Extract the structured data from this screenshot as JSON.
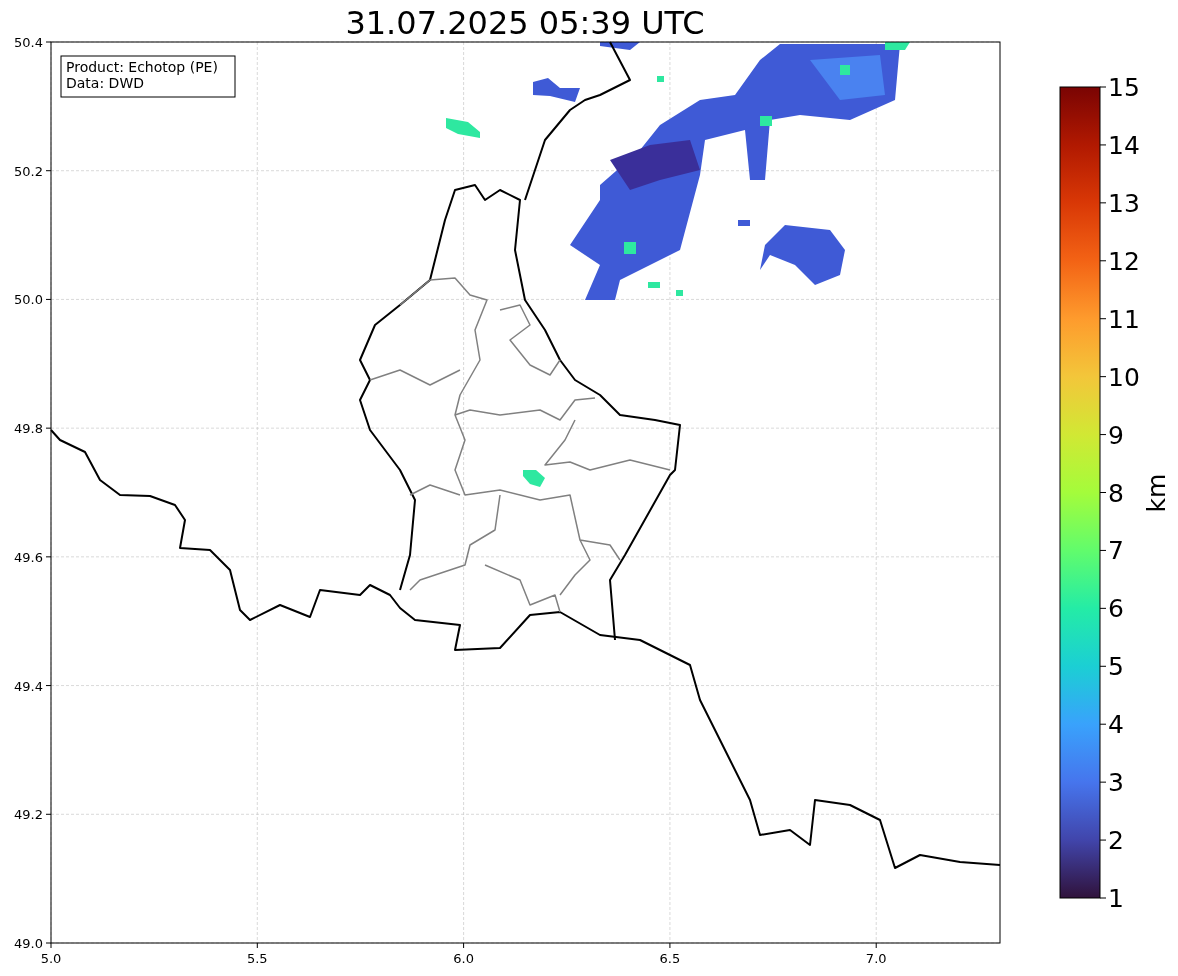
{
  "title": "31.07.2025 05:39 UTC",
  "legend": [
    "Product: Echotop (PE)",
    "Data: DWD"
  ],
  "xticks": [
    "5.0",
    "5.5",
    "6.0",
    "6.5",
    "7.0"
  ],
  "yticks": [
    "50.4",
    "50.2",
    "50.0",
    "49.8",
    "49.6",
    "49.4",
    "49.2",
    "49.0"
  ],
  "colorbar": {
    "label": "km",
    "ticks": [
      "15",
      "14",
      "13",
      "12",
      "11",
      "10",
      "9",
      "8",
      "7",
      "6",
      "5",
      "4",
      "3",
      "2",
      "1"
    ]
  }
}
